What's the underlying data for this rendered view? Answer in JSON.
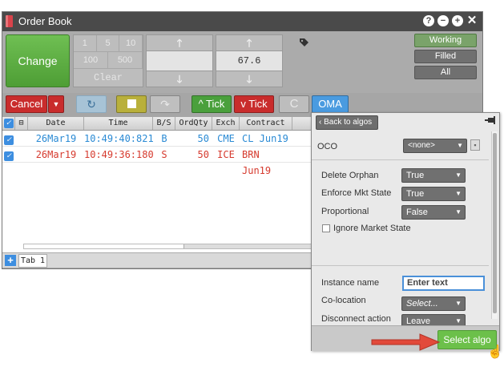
{
  "window": {
    "title": "Order Book",
    "title_icons": [
      "help-icon",
      "minimize-icon",
      "add-icon",
      "close-icon"
    ],
    "title_icon_glyphs": [
      "?",
      "−",
      "+",
      "✕"
    ]
  },
  "order_entry": {
    "change_label": "Change",
    "qty_buttons_row1": [
      "1",
      "5",
      "10"
    ],
    "qty_buttons_row2": [
      "100",
      "500"
    ],
    "clear_label": "Clear",
    "qty_field_value": "",
    "price_field_value": "67.6",
    "up_glyph": "🡑",
    "down_glyph": "🡓"
  },
  "status_filters": {
    "working": "Working",
    "filled": "Filled",
    "all": "All"
  },
  "toolbar": {
    "cancel_label": "Cancel",
    "cancel_dropdown_glyph": "▼",
    "reload_glyph": "↻",
    "redo_glyph": "↷",
    "tick_up_label": "^ Tick",
    "tick_down_label": "v Tick",
    "disabled_glyph": "C",
    "oma_label": "OMA"
  },
  "grid": {
    "columns": [
      "Date",
      "Time",
      "B/S",
      "OrdQty",
      "Exch",
      "Contract"
    ],
    "rows": [
      {
        "date": "26Mar19",
        "time": "10:49:40:821",
        "side": "B",
        "qty": "50",
        "exch": "CME",
        "contract": "CL Jun19"
      },
      {
        "date": "26Mar19",
        "time": "10:49:36:180",
        "side": "S",
        "qty": "50",
        "exch": "ICE",
        "contract": "BRN Jun19"
      }
    ],
    "tab_label": "Tab 1"
  },
  "algo_panel": {
    "back_label": "Back to algos",
    "oco_label": "OCO",
    "oco_value": "<none>",
    "delete_orphan_label": "Delete Orphan",
    "delete_orphan_value": "True",
    "enforce_mkt_state_label": "Enforce Mkt State",
    "enforce_mkt_state_value": "True",
    "proportional_label": "Proportional",
    "proportional_value": "False",
    "ignore_market_state_label": "Ignore Market State",
    "instance_name_label": "Instance name",
    "instance_name_placeholder": "Enter text",
    "co_location_label": "Co-location",
    "co_location_value": "Select...",
    "disconnect_action_label": "Disconnect action",
    "disconnect_action_value": "Leave",
    "select_algo_label": "Select algo"
  },
  "colors": {
    "buy": "#2a8ad4",
    "sell": "#d63a2e",
    "accent_blue": "#3d8ee0",
    "change_green": "#4e9e35",
    "arrow_red": "#e24a3b"
  }
}
